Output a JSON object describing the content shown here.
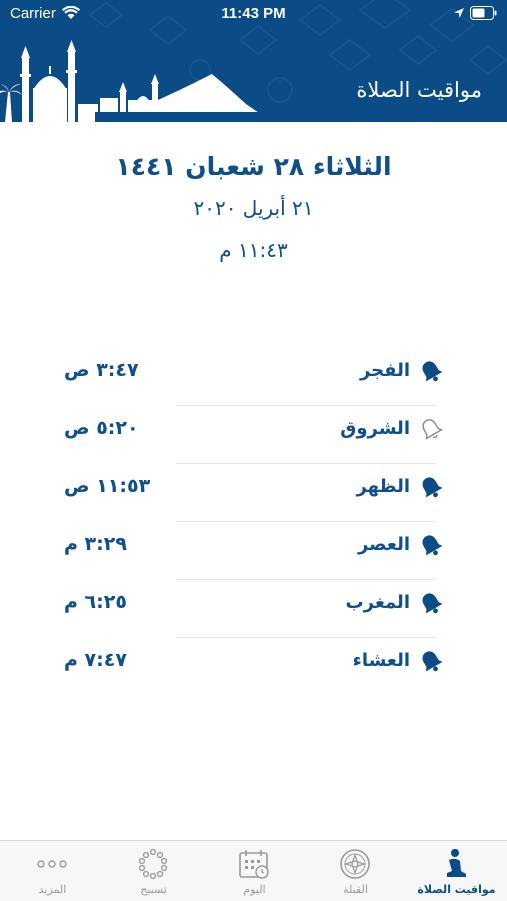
{
  "status": {
    "carrier": "Carrier",
    "time": "11:43 PM"
  },
  "header": {
    "title": "مواقيت الصلاة",
    "color": "#0b4b86"
  },
  "date": {
    "hijri": "الثلاثاء ٢٨ شعبان ١٤٤١",
    "gregorian": "٢١ أبريل ٢٠٢٠",
    "clock": "١١:٤٣ م"
  },
  "prayers": [
    {
      "name": "الفجر",
      "time": "٣:٤٧ ص",
      "alert": "on"
    },
    {
      "name": "الشروق",
      "time": "٥:٢٠ ص",
      "alert": "off"
    },
    {
      "name": "الظهر",
      "time": "١١:٥٣ ص",
      "alert": "on"
    },
    {
      "name": "العصر",
      "time": "٣:٢٩ م",
      "alert": "on"
    },
    {
      "name": "المغرب",
      "time": "٦:٢٥ م",
      "alert": "on"
    },
    {
      "name": "العشاء",
      "time": "٧:٤٧ م",
      "alert": "on"
    }
  ],
  "tabs": [
    {
      "label": "مواقيت الصلاة",
      "icon": "praying-person-icon",
      "active": true
    },
    {
      "label": "القبلة",
      "icon": "compass-icon",
      "active": false
    },
    {
      "label": "اليوم",
      "icon": "calendar-icon",
      "active": false
    },
    {
      "label": "تسبيح",
      "icon": "prayer-beads-icon",
      "active": false
    },
    {
      "label": "المزيد",
      "icon": "more-dots-icon",
      "active": false
    }
  ],
  "colors": {
    "accent": "#0b4b86",
    "text": "#0e4f8c",
    "inactive": "#9a9a9a"
  }
}
